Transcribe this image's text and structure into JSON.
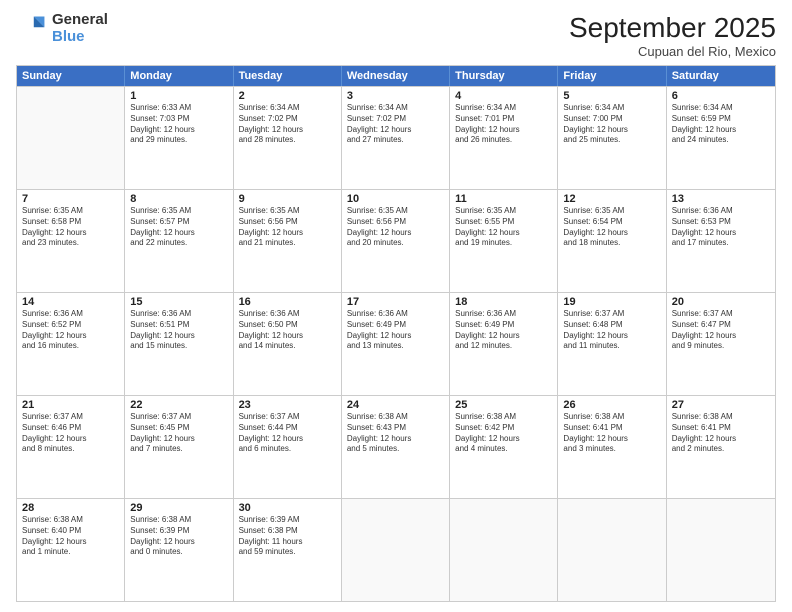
{
  "logo": {
    "general": "General",
    "blue": "Blue"
  },
  "header": {
    "month": "September 2025",
    "location": "Cupuan del Rio, Mexico"
  },
  "weekdays": [
    "Sunday",
    "Monday",
    "Tuesday",
    "Wednesday",
    "Thursday",
    "Friday",
    "Saturday"
  ],
  "rows": [
    [
      {
        "day": "",
        "info": ""
      },
      {
        "day": "1",
        "info": "Sunrise: 6:33 AM\nSunset: 7:03 PM\nDaylight: 12 hours\nand 29 minutes."
      },
      {
        "day": "2",
        "info": "Sunrise: 6:34 AM\nSunset: 7:02 PM\nDaylight: 12 hours\nand 28 minutes."
      },
      {
        "day": "3",
        "info": "Sunrise: 6:34 AM\nSunset: 7:02 PM\nDaylight: 12 hours\nand 27 minutes."
      },
      {
        "day": "4",
        "info": "Sunrise: 6:34 AM\nSunset: 7:01 PM\nDaylight: 12 hours\nand 26 minutes."
      },
      {
        "day": "5",
        "info": "Sunrise: 6:34 AM\nSunset: 7:00 PM\nDaylight: 12 hours\nand 25 minutes."
      },
      {
        "day": "6",
        "info": "Sunrise: 6:34 AM\nSunset: 6:59 PM\nDaylight: 12 hours\nand 24 minutes."
      }
    ],
    [
      {
        "day": "7",
        "info": "Sunrise: 6:35 AM\nSunset: 6:58 PM\nDaylight: 12 hours\nand 23 minutes."
      },
      {
        "day": "8",
        "info": "Sunrise: 6:35 AM\nSunset: 6:57 PM\nDaylight: 12 hours\nand 22 minutes."
      },
      {
        "day": "9",
        "info": "Sunrise: 6:35 AM\nSunset: 6:56 PM\nDaylight: 12 hours\nand 21 minutes."
      },
      {
        "day": "10",
        "info": "Sunrise: 6:35 AM\nSunset: 6:56 PM\nDaylight: 12 hours\nand 20 minutes."
      },
      {
        "day": "11",
        "info": "Sunrise: 6:35 AM\nSunset: 6:55 PM\nDaylight: 12 hours\nand 19 minutes."
      },
      {
        "day": "12",
        "info": "Sunrise: 6:35 AM\nSunset: 6:54 PM\nDaylight: 12 hours\nand 18 minutes."
      },
      {
        "day": "13",
        "info": "Sunrise: 6:36 AM\nSunset: 6:53 PM\nDaylight: 12 hours\nand 17 minutes."
      }
    ],
    [
      {
        "day": "14",
        "info": "Sunrise: 6:36 AM\nSunset: 6:52 PM\nDaylight: 12 hours\nand 16 minutes."
      },
      {
        "day": "15",
        "info": "Sunrise: 6:36 AM\nSunset: 6:51 PM\nDaylight: 12 hours\nand 15 minutes."
      },
      {
        "day": "16",
        "info": "Sunrise: 6:36 AM\nSunset: 6:50 PM\nDaylight: 12 hours\nand 14 minutes."
      },
      {
        "day": "17",
        "info": "Sunrise: 6:36 AM\nSunset: 6:49 PM\nDaylight: 12 hours\nand 13 minutes."
      },
      {
        "day": "18",
        "info": "Sunrise: 6:36 AM\nSunset: 6:49 PM\nDaylight: 12 hours\nand 12 minutes."
      },
      {
        "day": "19",
        "info": "Sunrise: 6:37 AM\nSunset: 6:48 PM\nDaylight: 12 hours\nand 11 minutes."
      },
      {
        "day": "20",
        "info": "Sunrise: 6:37 AM\nSunset: 6:47 PM\nDaylight: 12 hours\nand 9 minutes."
      }
    ],
    [
      {
        "day": "21",
        "info": "Sunrise: 6:37 AM\nSunset: 6:46 PM\nDaylight: 12 hours\nand 8 minutes."
      },
      {
        "day": "22",
        "info": "Sunrise: 6:37 AM\nSunset: 6:45 PM\nDaylight: 12 hours\nand 7 minutes."
      },
      {
        "day": "23",
        "info": "Sunrise: 6:37 AM\nSunset: 6:44 PM\nDaylight: 12 hours\nand 6 minutes."
      },
      {
        "day": "24",
        "info": "Sunrise: 6:38 AM\nSunset: 6:43 PM\nDaylight: 12 hours\nand 5 minutes."
      },
      {
        "day": "25",
        "info": "Sunrise: 6:38 AM\nSunset: 6:42 PM\nDaylight: 12 hours\nand 4 minutes."
      },
      {
        "day": "26",
        "info": "Sunrise: 6:38 AM\nSunset: 6:41 PM\nDaylight: 12 hours\nand 3 minutes."
      },
      {
        "day": "27",
        "info": "Sunrise: 6:38 AM\nSunset: 6:41 PM\nDaylight: 12 hours\nand 2 minutes."
      }
    ],
    [
      {
        "day": "28",
        "info": "Sunrise: 6:38 AM\nSunset: 6:40 PM\nDaylight: 12 hours\nand 1 minute."
      },
      {
        "day": "29",
        "info": "Sunrise: 6:38 AM\nSunset: 6:39 PM\nDaylight: 12 hours\nand 0 minutes."
      },
      {
        "day": "30",
        "info": "Sunrise: 6:39 AM\nSunset: 6:38 PM\nDaylight: 11 hours\nand 59 minutes."
      },
      {
        "day": "",
        "info": ""
      },
      {
        "day": "",
        "info": ""
      },
      {
        "day": "",
        "info": ""
      },
      {
        "day": "",
        "info": ""
      }
    ]
  ]
}
